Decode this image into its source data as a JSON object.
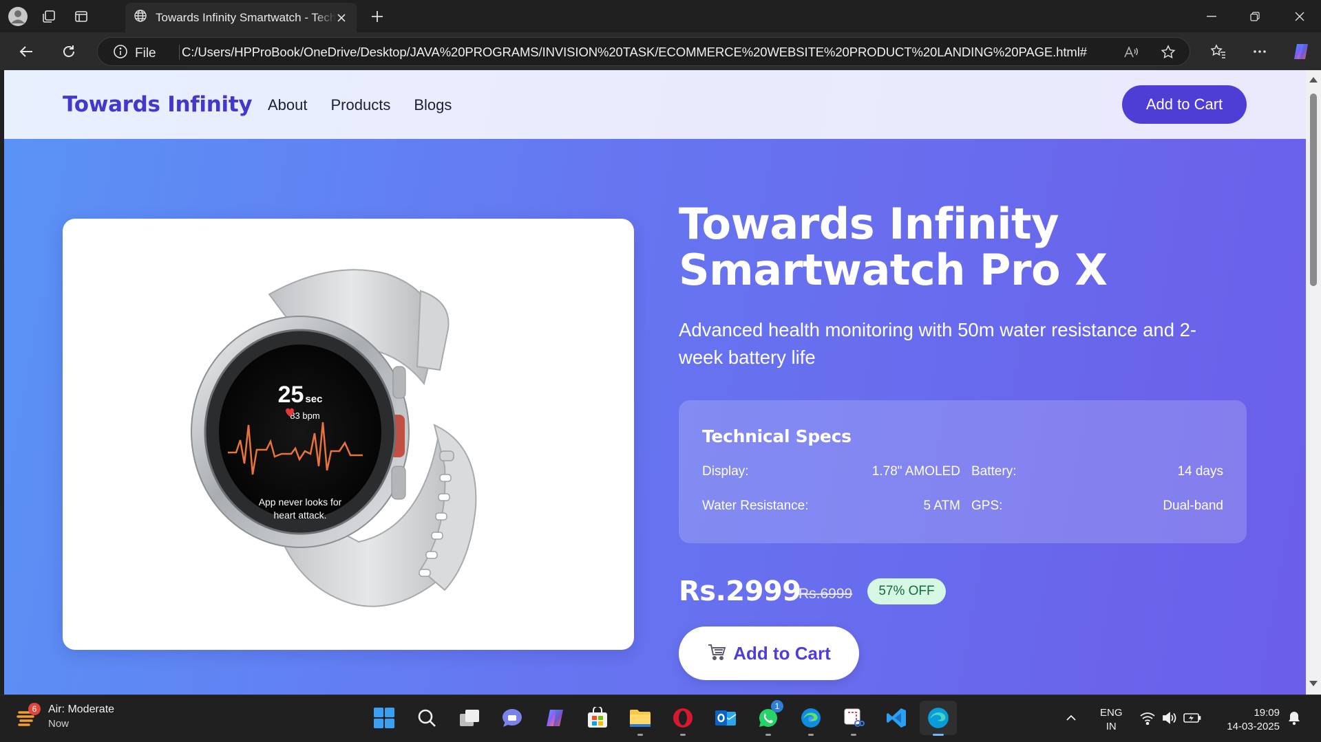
{
  "browser": {
    "tab_title": "Towards Infinity Smartwatch - Tech",
    "url_scheme": "File",
    "url": "C:/Users/HPProBook/OneDrive/Desktop/JAVA%20PROGRAMS/INVISION%20TASK/ECOMMERCE%20WEBSITE%20PRODUCT%20LANDING%20PAGE.html#"
  },
  "site": {
    "brand": "Towards Infinity",
    "nav": [
      "About",
      "Products",
      "Blogs"
    ],
    "header_cart_label": "Add to Cart"
  },
  "product": {
    "title_line1": "Towards Infinity",
    "title_line2": "Smartwatch Pro X",
    "subtitle": "Advanced health monitoring with 50m water resistance and 2-week battery life",
    "image": {
      "watch_seconds": "25",
      "watch_seconds_unit": "sec",
      "watch_bpm": "83 bpm",
      "watch_message_line1": "App never looks for",
      "watch_message_line2": "heart attack."
    },
    "specs_title": "Technical Specs",
    "specs": [
      {
        "label": "Display:",
        "value": "1.78\" AMOLED"
      },
      {
        "label": "Battery:",
        "value": "14 days"
      },
      {
        "label": "Water Resistance:",
        "value": "5 ATM"
      },
      {
        "label": "GPS:",
        "value": "Dual-band"
      }
    ],
    "price": "Rs.2999",
    "old_price": "Rs.6999",
    "discount_badge": "57% OFF",
    "cart_button_label": "Add to Cart"
  },
  "taskbar": {
    "weather_title": "Air: Moderate",
    "weather_sub": "Now",
    "weather_badge": "6",
    "whatsapp_badge": "1",
    "lang_line1": "ENG",
    "lang_line2": "IN",
    "time": "19:09",
    "date": "14-03-2025"
  },
  "colors": {
    "brand": "#4338ca",
    "accent_button": "#4f3ed6",
    "gradient_start": "#5a93f5",
    "gradient_end": "#6b5ee9",
    "discount_bg": "#d6f7e3"
  }
}
